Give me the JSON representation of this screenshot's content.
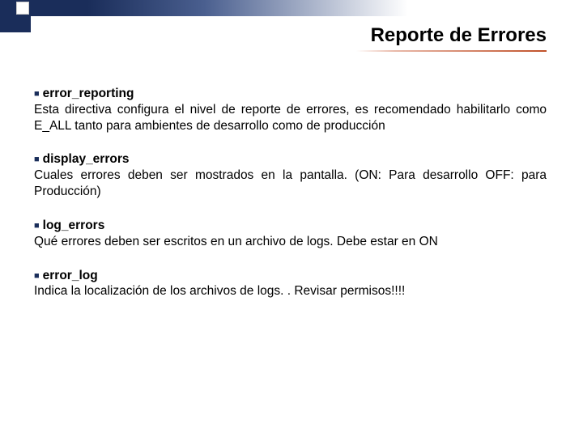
{
  "title": "Reporte de Errores",
  "items": [
    {
      "heading": "error_reporting",
      "desc": "Esta directiva configura el nivel de reporte de errores, es recomendado habilitarlo como E_ALL tanto para ambientes de desarrollo como de producción"
    },
    {
      "heading": "display_errors",
      "desc": "Cuales errores deben ser mostrados en la pantalla. (ON: Para desarrollo OFF: para Producción)"
    },
    {
      "heading": "log_errors",
      "desc": "Qué errores deben ser escritos en un archivo de logs.  Debe estar en ON"
    },
    {
      "heading": "error_log",
      "desc": "Indica la localización de los archivos de logs. .  Revisar permisos!!!!"
    }
  ]
}
